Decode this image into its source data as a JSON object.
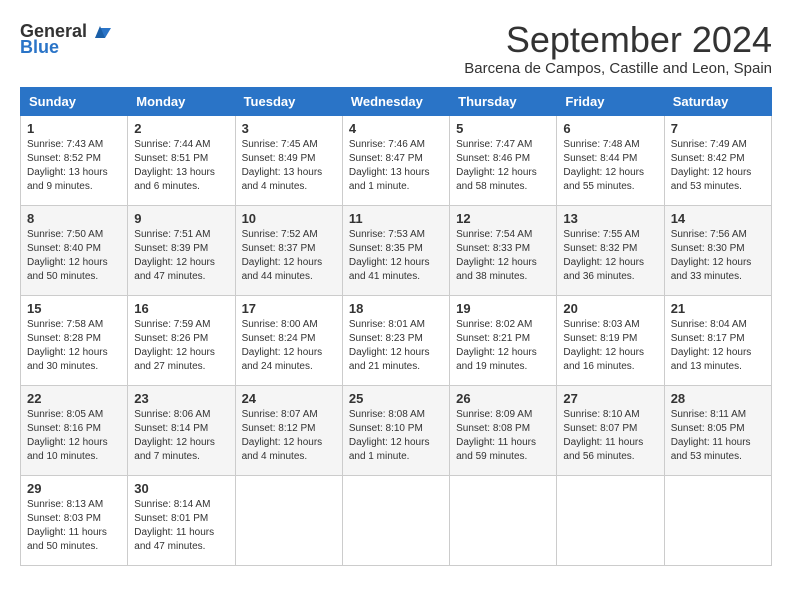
{
  "header": {
    "logo_general": "General",
    "logo_blue": "Blue",
    "month_title": "September 2024",
    "location": "Barcena de Campos, Castille and Leon, Spain"
  },
  "days_of_week": [
    "Sunday",
    "Monday",
    "Tuesday",
    "Wednesday",
    "Thursday",
    "Friday",
    "Saturday"
  ],
  "weeks": [
    [
      {
        "day": "1",
        "sunrise": "Sunrise: 7:43 AM",
        "sunset": "Sunset: 8:52 PM",
        "daylight": "Daylight: 13 hours and 9 minutes."
      },
      {
        "day": "2",
        "sunrise": "Sunrise: 7:44 AM",
        "sunset": "Sunset: 8:51 PM",
        "daylight": "Daylight: 13 hours and 6 minutes."
      },
      {
        "day": "3",
        "sunrise": "Sunrise: 7:45 AM",
        "sunset": "Sunset: 8:49 PM",
        "daylight": "Daylight: 13 hours and 4 minutes."
      },
      {
        "day": "4",
        "sunrise": "Sunrise: 7:46 AM",
        "sunset": "Sunset: 8:47 PM",
        "daylight": "Daylight: 13 hours and 1 minute."
      },
      {
        "day": "5",
        "sunrise": "Sunrise: 7:47 AM",
        "sunset": "Sunset: 8:46 PM",
        "daylight": "Daylight: 12 hours and 58 minutes."
      },
      {
        "day": "6",
        "sunrise": "Sunrise: 7:48 AM",
        "sunset": "Sunset: 8:44 PM",
        "daylight": "Daylight: 12 hours and 55 minutes."
      },
      {
        "day": "7",
        "sunrise": "Sunrise: 7:49 AM",
        "sunset": "Sunset: 8:42 PM",
        "daylight": "Daylight: 12 hours and 53 minutes."
      }
    ],
    [
      {
        "day": "8",
        "sunrise": "Sunrise: 7:50 AM",
        "sunset": "Sunset: 8:40 PM",
        "daylight": "Daylight: 12 hours and 50 minutes."
      },
      {
        "day": "9",
        "sunrise": "Sunrise: 7:51 AM",
        "sunset": "Sunset: 8:39 PM",
        "daylight": "Daylight: 12 hours and 47 minutes."
      },
      {
        "day": "10",
        "sunrise": "Sunrise: 7:52 AM",
        "sunset": "Sunset: 8:37 PM",
        "daylight": "Daylight: 12 hours and 44 minutes."
      },
      {
        "day": "11",
        "sunrise": "Sunrise: 7:53 AM",
        "sunset": "Sunset: 8:35 PM",
        "daylight": "Daylight: 12 hours and 41 minutes."
      },
      {
        "day": "12",
        "sunrise": "Sunrise: 7:54 AM",
        "sunset": "Sunset: 8:33 PM",
        "daylight": "Daylight: 12 hours and 38 minutes."
      },
      {
        "day": "13",
        "sunrise": "Sunrise: 7:55 AM",
        "sunset": "Sunset: 8:32 PM",
        "daylight": "Daylight: 12 hours and 36 minutes."
      },
      {
        "day": "14",
        "sunrise": "Sunrise: 7:56 AM",
        "sunset": "Sunset: 8:30 PM",
        "daylight": "Daylight: 12 hours and 33 minutes."
      }
    ],
    [
      {
        "day": "15",
        "sunrise": "Sunrise: 7:58 AM",
        "sunset": "Sunset: 8:28 PM",
        "daylight": "Daylight: 12 hours and 30 minutes."
      },
      {
        "day": "16",
        "sunrise": "Sunrise: 7:59 AM",
        "sunset": "Sunset: 8:26 PM",
        "daylight": "Daylight: 12 hours and 27 minutes."
      },
      {
        "day": "17",
        "sunrise": "Sunrise: 8:00 AM",
        "sunset": "Sunset: 8:24 PM",
        "daylight": "Daylight: 12 hours and 24 minutes."
      },
      {
        "day": "18",
        "sunrise": "Sunrise: 8:01 AM",
        "sunset": "Sunset: 8:23 PM",
        "daylight": "Daylight: 12 hours and 21 minutes."
      },
      {
        "day": "19",
        "sunrise": "Sunrise: 8:02 AM",
        "sunset": "Sunset: 8:21 PM",
        "daylight": "Daylight: 12 hours and 19 minutes."
      },
      {
        "day": "20",
        "sunrise": "Sunrise: 8:03 AM",
        "sunset": "Sunset: 8:19 PM",
        "daylight": "Daylight: 12 hours and 16 minutes."
      },
      {
        "day": "21",
        "sunrise": "Sunrise: 8:04 AM",
        "sunset": "Sunset: 8:17 PM",
        "daylight": "Daylight: 12 hours and 13 minutes."
      }
    ],
    [
      {
        "day": "22",
        "sunrise": "Sunrise: 8:05 AM",
        "sunset": "Sunset: 8:16 PM",
        "daylight": "Daylight: 12 hours and 10 minutes."
      },
      {
        "day": "23",
        "sunrise": "Sunrise: 8:06 AM",
        "sunset": "Sunset: 8:14 PM",
        "daylight": "Daylight: 12 hours and 7 minutes."
      },
      {
        "day": "24",
        "sunrise": "Sunrise: 8:07 AM",
        "sunset": "Sunset: 8:12 PM",
        "daylight": "Daylight: 12 hours and 4 minutes."
      },
      {
        "day": "25",
        "sunrise": "Sunrise: 8:08 AM",
        "sunset": "Sunset: 8:10 PM",
        "daylight": "Daylight: 12 hours and 1 minute."
      },
      {
        "day": "26",
        "sunrise": "Sunrise: 8:09 AM",
        "sunset": "Sunset: 8:08 PM",
        "daylight": "Daylight: 11 hours and 59 minutes."
      },
      {
        "day": "27",
        "sunrise": "Sunrise: 8:10 AM",
        "sunset": "Sunset: 8:07 PM",
        "daylight": "Daylight: 11 hours and 56 minutes."
      },
      {
        "day": "28",
        "sunrise": "Sunrise: 8:11 AM",
        "sunset": "Sunset: 8:05 PM",
        "daylight": "Daylight: 11 hours and 53 minutes."
      }
    ],
    [
      {
        "day": "29",
        "sunrise": "Sunrise: 8:13 AM",
        "sunset": "Sunset: 8:03 PM",
        "daylight": "Daylight: 11 hours and 50 minutes."
      },
      {
        "day": "30",
        "sunrise": "Sunrise: 8:14 AM",
        "sunset": "Sunset: 8:01 PM",
        "daylight": "Daylight: 11 hours and 47 minutes."
      },
      null,
      null,
      null,
      null,
      null
    ]
  ]
}
